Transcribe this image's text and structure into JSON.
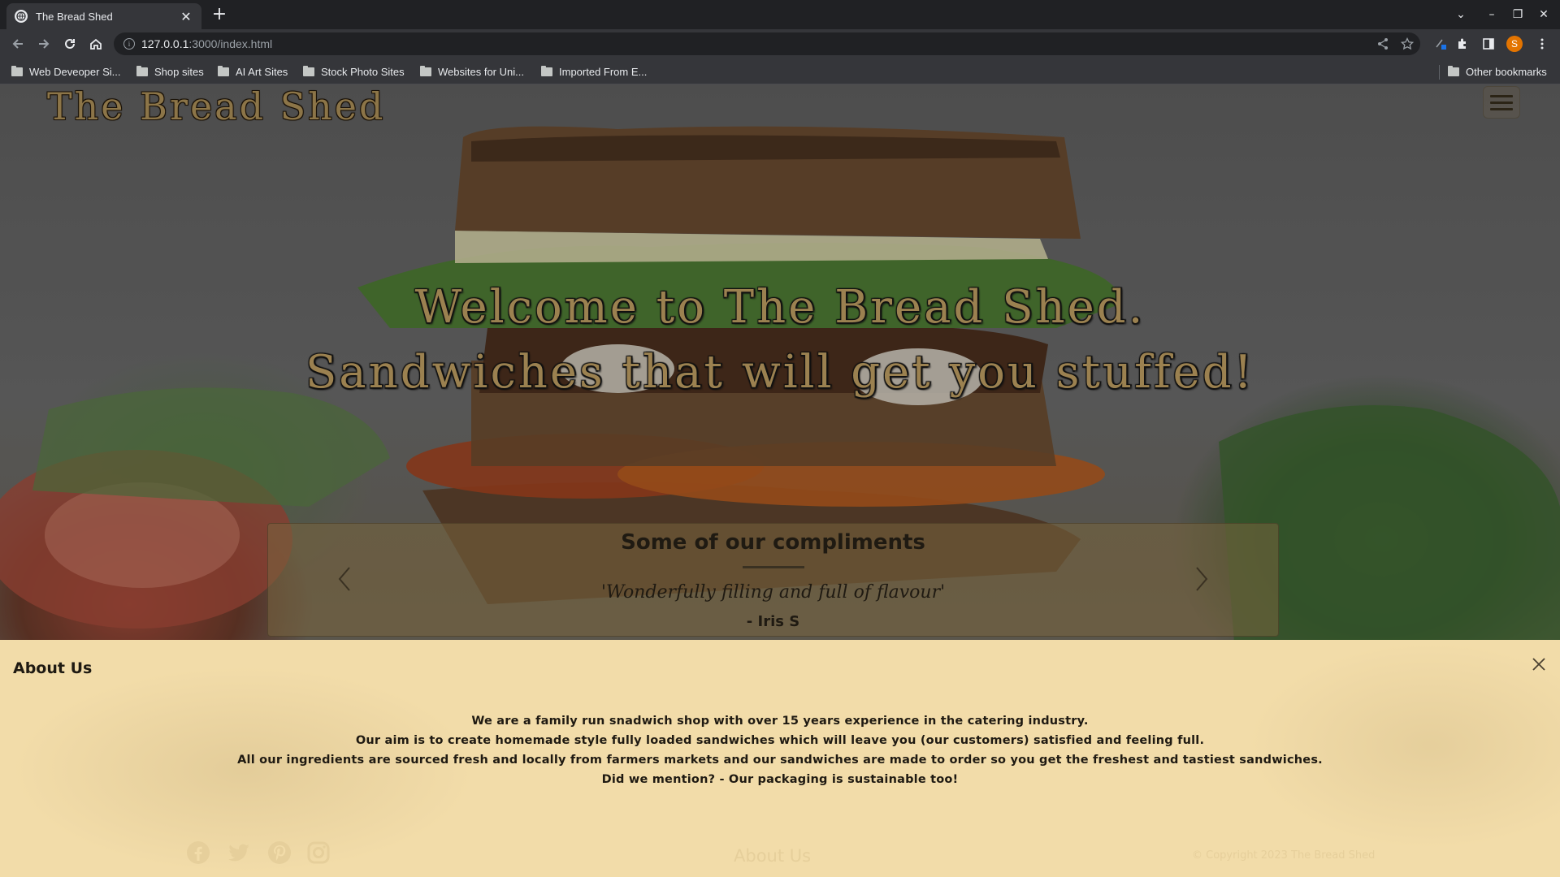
{
  "browser": {
    "tab_title": "The Bread Shed",
    "url_host": "127.0.0.1",
    "url_path": ":3000/index.html",
    "profile_initial": "S",
    "bookmarks": [
      "Web Deveoper Si...",
      "Shop sites",
      "AI Art Sites",
      "Stock Photo Sites",
      "Websites for Uni...",
      "Imported From E..."
    ],
    "other_bookmarks": "Other bookmarks"
  },
  "header": {
    "brand": "The Bread Shed"
  },
  "hero": {
    "headline_line1": "Welcome to The Bread Shed.",
    "headline_line2": "Sandwiches that will get you stuffed!"
  },
  "testimonials": {
    "title": "Some of our compliments",
    "quote": "'Wonderfully filling and full of flavour'",
    "author": "- Iris S"
  },
  "about": {
    "title": "About Us",
    "lines": [
      "We are a family run snadwich shop with over 15 years experience in the catering industry.",
      "Our aim is to create homemade style fully loaded sandwiches which will leave you (our customers) satisfied and feeling full.",
      "All our ingredients are sourced fresh and locally from farmers markets and our sandwiches are made to order so you get the freshest and tastiest sandwiches.",
      "Did we mention? - Our packaging is sustainable too!"
    ]
  },
  "footer": {
    "link": "About Us",
    "copyright": "© Copyright 2023 The Bread Shed",
    "social_icons": [
      "facebook-icon",
      "twitter-icon",
      "pinterest-icon",
      "instagram-icon"
    ]
  },
  "colors": {
    "brand": "#8c7548",
    "modal_bg": "#f2dca9",
    "footer_text": "#e6cf9b"
  }
}
